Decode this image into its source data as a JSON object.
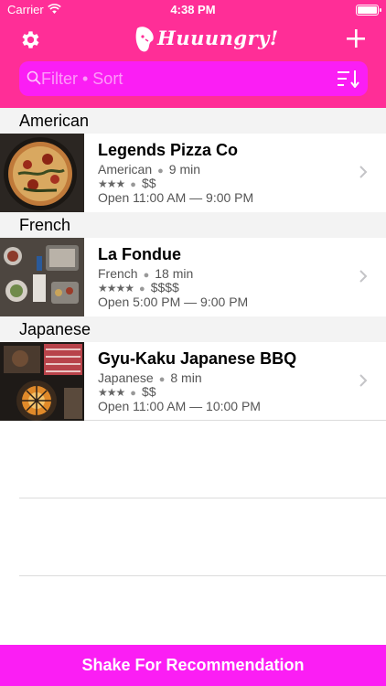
{
  "status_bar": {
    "carrier": "Carrier",
    "time": "4:38 PM"
  },
  "header": {
    "logo_text": "Huuungry!",
    "search": {
      "placeholder": "Filter • Sort",
      "value": ""
    }
  },
  "icons": {
    "settings": "gear-icon",
    "add": "plus-icon",
    "search": "search-icon",
    "sort": "sort-icon",
    "chevron": "chevron-right-icon"
  },
  "colors": {
    "header_bg": "#ff2e97",
    "accent": "#fb1ef4",
    "section_bg": "#f3f3f3"
  },
  "sections": [
    {
      "title": "American",
      "rows": [
        {
          "name": "Legends Pizza Co",
          "cuisine": "American",
          "time": "9 min",
          "stars": "★★★",
          "rating": 3,
          "price": "$$",
          "hours": "Open 11:00 AM — 9:00 PM"
        }
      ]
    },
    {
      "title": "French",
      "rows": [
        {
          "name": "La Fondue",
          "cuisine": "French",
          "time": "18 min",
          "stars": "★★★★",
          "rating": 4,
          "price": "$$$$",
          "hours": "Open 5:00 PM — 9:00 PM"
        }
      ]
    },
    {
      "title": "Japanese",
      "rows": [
        {
          "name": "Gyu-Kaku Japanese BBQ",
          "cuisine": "Japanese",
          "time": "8 min",
          "stars": "★★★",
          "rating": 3,
          "price": "$$",
          "hours": "Open 11:00 AM — 10:00 PM"
        }
      ]
    }
  ],
  "footer": {
    "button_label": "Shake For Recommendation"
  }
}
